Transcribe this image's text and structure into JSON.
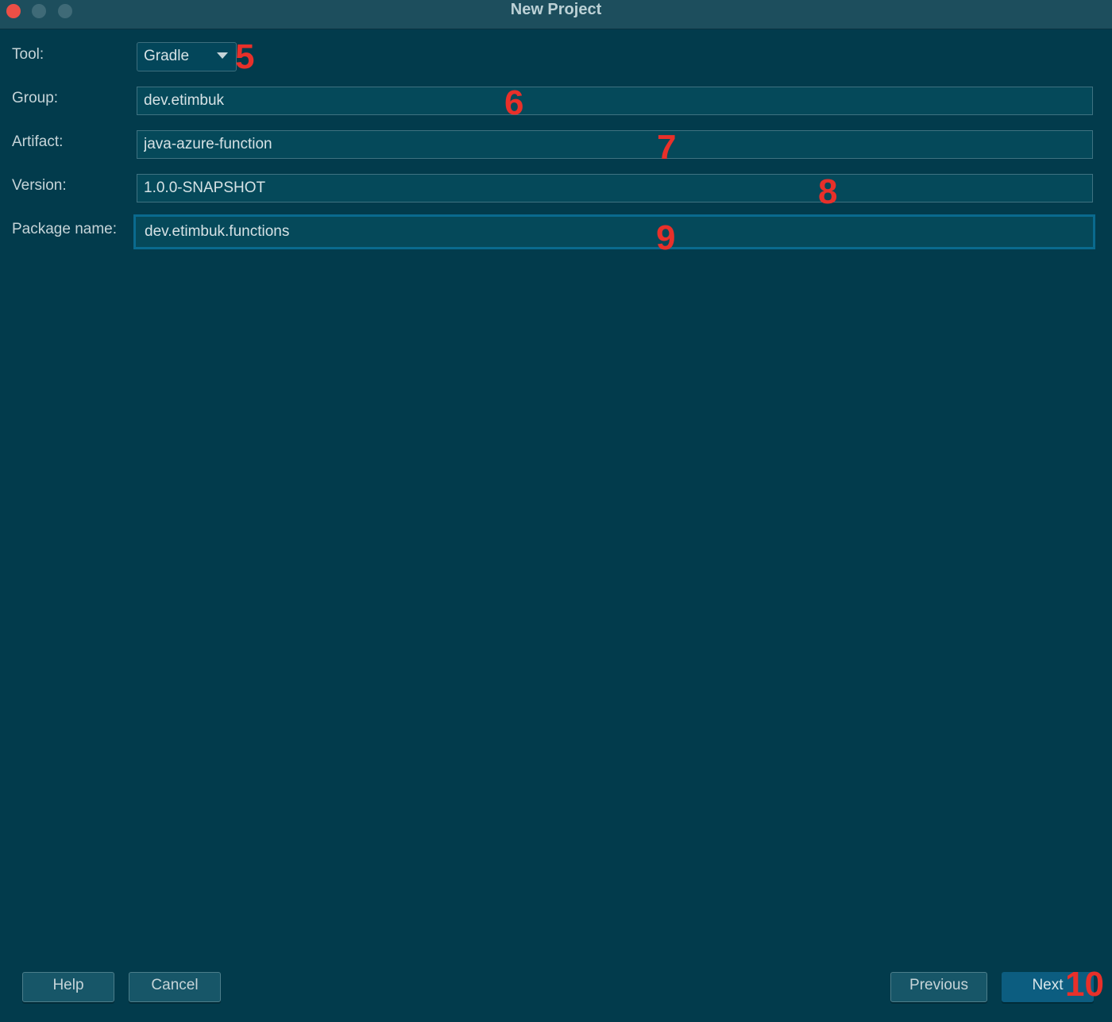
{
  "window": {
    "title": "New Project"
  },
  "form": {
    "tool": {
      "label": "Tool:",
      "value": "Gradle"
    },
    "group": {
      "label": "Group:",
      "value": "dev.etimbuk"
    },
    "artifact": {
      "label": "Artifact:",
      "value": "java-azure-function"
    },
    "version": {
      "label": "Version:",
      "value": "1.0.0-SNAPSHOT"
    },
    "package": {
      "label": "Package name:",
      "value": "dev.etimbuk.functions"
    }
  },
  "annotations": [
    "5",
    "6",
    "7",
    "8",
    "9",
    "10"
  ],
  "buttons": {
    "help": "Help",
    "cancel": "Cancel",
    "previous": "Previous",
    "next": "Next"
  },
  "colors": {
    "background": "#023b4c",
    "annotation": "#e8302a",
    "primary_button": "#0c5d80"
  },
  "icons": {
    "dropdown": "chevron-down-icon"
  }
}
